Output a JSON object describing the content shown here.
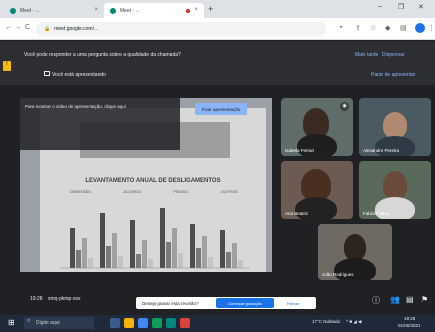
{
  "browser": {
    "tabs": [
      {
        "label": "Meet - ...",
        "active": false
      },
      {
        "label": "Meet - ...",
        "active": true
      }
    ],
    "new_tab": "+",
    "url": "meet.google.com/..."
  },
  "banner": {
    "question": "Você pode responder a uma pergunta sobre a qualidade da chamada?",
    "action_later": "Mais tarde",
    "action_dismiss": "Dispensar",
    "presenting_text": "Você está apresentando",
    "stop_presenting": "Parar de apresentar"
  },
  "presentation": {
    "overlay_text": "Para mostrar o vídeo de apresentação, clique aqui",
    "pin_button": "Fixar apresentação",
    "slide_title": "LEVANTAMENTO ANUAL DE DESLIGAMENTOS",
    "legend": [
      "DEMISSÃO",
      "ACORDO",
      "PEDIDO",
      "OUTROS"
    ],
    "legend_colors": [
      "#4d4d4d",
      "#7a7a7a",
      "#a0a0a0",
      "#c4c4c4"
    ]
  },
  "participants": [
    {
      "name": "Isabela Ferrari",
      "tile_bg": "#5f6d6a"
    },
    {
      "name": "Alexandre Pereira",
      "tile_bg": "#4a5a62"
    },
    {
      "name": "Ana Beatriz",
      "tile_bg": "#6b5b52"
    },
    {
      "name": "Fabíola Silva",
      "tile_bg": "#5a6a5a"
    },
    {
      "name": "João Rodrigues",
      "tile_bg": "#6e6a62"
    }
  ],
  "meetbar": {
    "time": "19:28",
    "meeting_code": "xmq-pkmp-xsx",
    "toast_text": "Deseja gravar esta reunião?",
    "toast_accept": "Começar gravação",
    "toast_reject": "Fechar"
  },
  "taskbar": {
    "search_placeholder": "Digite aqui",
    "weather": "17°C Nublado",
    "clock_time": "19:28",
    "clock_date": "01/06/2021"
  }
}
